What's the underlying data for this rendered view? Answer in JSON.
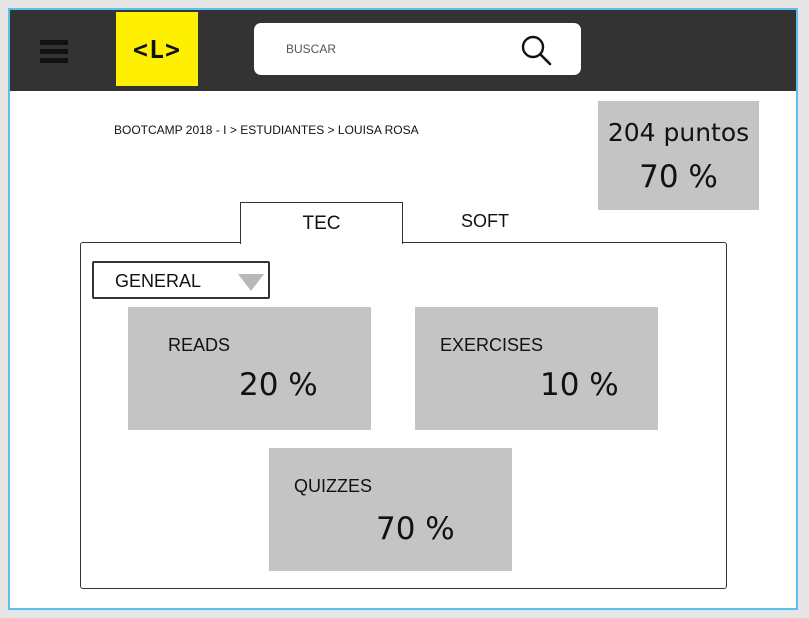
{
  "header": {
    "logo_text": "<L>",
    "search": {
      "placeholder": "BUSCAR"
    }
  },
  "breadcrumb": {
    "items": [
      "BOOTCAMP 2018 - I",
      "ESTUDIANTES",
      "LOUISA ROSA"
    ],
    "separator": ">"
  },
  "score": {
    "points": "204 puntos",
    "percent": "70 %"
  },
  "tabs": {
    "tec": "TEC",
    "soft": "SOFT",
    "active": "TEC"
  },
  "filter": {
    "selected": "GENERAL"
  },
  "stats": {
    "reads": {
      "label": "READS",
      "value": "20 %"
    },
    "exercises": {
      "label": "EXERCISES",
      "value": "10 %"
    },
    "quizzes": {
      "label": "QUIZZES",
      "value": "70 %"
    }
  },
  "colors": {
    "topbar": "#333333",
    "logo_bg": "#ffef00",
    "card_bg": "#c4c4c4",
    "frame_border": "#5bc0eb"
  },
  "icons": [
    "hamburger-menu-icon",
    "search-icon",
    "triangle-down-icon"
  ]
}
